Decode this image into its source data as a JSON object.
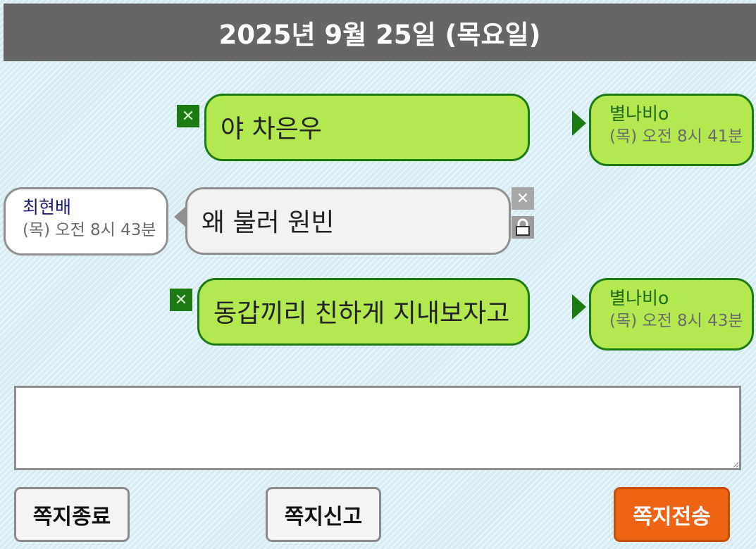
{
  "header": {
    "date": "2025년 9월 25일 (목요일)"
  },
  "messages": [
    {
      "text": "야 차은우",
      "sender": "별나비o",
      "time": "(목) 오전 8시 41분",
      "side": "mine"
    },
    {
      "text": "왜 불러 원빈",
      "sender": "최현배",
      "time": "(목) 오전 8시 43분",
      "side": "theirs"
    },
    {
      "text": "동갑끼리 친하게 지내보자고",
      "sender": "별나비o",
      "time": "(목) 오전 8시 43분",
      "side": "mine"
    }
  ],
  "icons": {
    "delete": "close-icon",
    "block": "lock-icon",
    "pointer": "triangle-right-icon"
  },
  "compose": {
    "value": "",
    "placeholder": ""
  },
  "buttons": {
    "close": "쪽지종료",
    "report": "쪽지신고",
    "send": "쪽지전송"
  },
  "colors": {
    "header_bg": "#666666",
    "my_bubble": "#b4e850",
    "my_border": "#1b7a12",
    "their_bubble": "#f2f2f2",
    "send_button": "#ee6415"
  }
}
